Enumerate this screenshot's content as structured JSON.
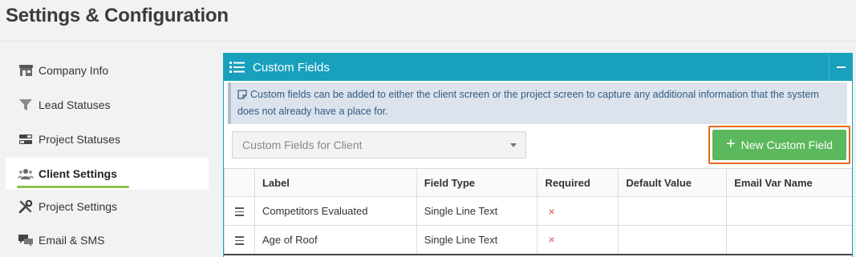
{
  "page": {
    "title": "Settings & Configuration"
  },
  "sidebar": {
    "items": [
      {
        "label": "Company Info",
        "icon": "store-icon"
      },
      {
        "label": "Lead Statuses",
        "icon": "funnel-icon"
      },
      {
        "label": "Project Statuses",
        "icon": "toggles-icon"
      },
      {
        "label": "Client Settings",
        "icon": "users-icon",
        "active": true
      },
      {
        "label": "Project Settings",
        "icon": "tools-icon"
      },
      {
        "label": "Email & SMS",
        "icon": "chat-bubbles-icon"
      }
    ]
  },
  "panel": {
    "title": "Custom Fields",
    "info": "Custom fields can be added to either the client screen or the project screen to capture any additional information that the system does not already have a place for.",
    "select_value": "Custom Fields for Client",
    "new_button_label": "New Custom Field",
    "accent_color": "#18a0bd",
    "button_color": "#5cb85c",
    "highlight_color": "#e8691e"
  },
  "table": {
    "headers": [
      "Label",
      "Field Type",
      "Required",
      "Default Value",
      "Email Var Name"
    ],
    "rows": [
      {
        "label": "Competitors Evaluated",
        "field_type": "Single Line Text",
        "required": "×",
        "default_value": "",
        "email_var_name": ""
      },
      {
        "label": "Age of Roof",
        "field_type": "Single Line Text",
        "required": "×",
        "default_value": "",
        "email_var_name": ""
      }
    ]
  }
}
